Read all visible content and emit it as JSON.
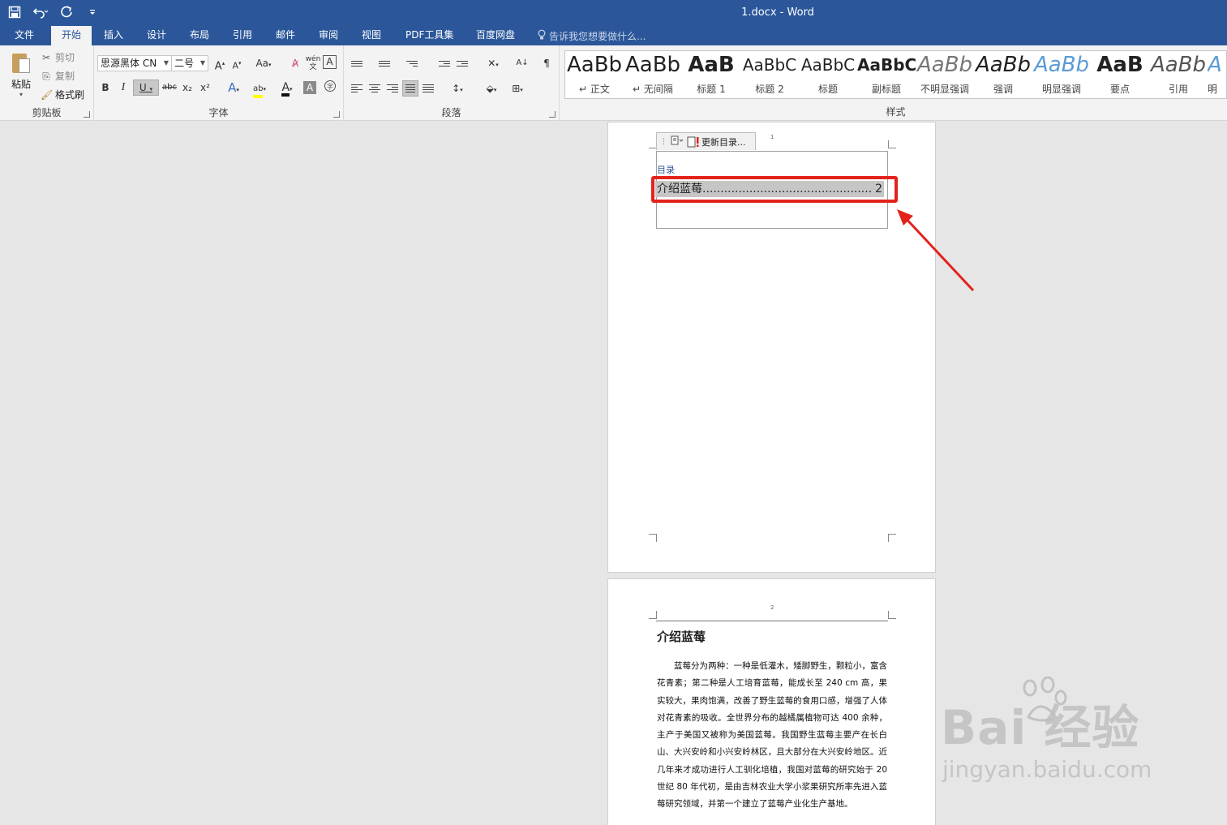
{
  "titlebar": {
    "document_title": "1.docx - Word",
    "qat_icons": [
      "save-icon",
      "undo-icon",
      "redo-icon",
      "customize-icon"
    ],
    "background": "#2b579a"
  },
  "tabs": {
    "file": "文件",
    "home": "开始",
    "insert": "插入",
    "design": "设计",
    "layout": "布局",
    "references": "引用",
    "mailings": "邮件",
    "review": "审阅",
    "view": "视图",
    "pdf_tools": "PDF工具集",
    "baidu_pan": "百度网盘",
    "tell_me": "告诉我您想要做什么..."
  },
  "ribbon": {
    "clipboard": {
      "label": "剪贴板",
      "paste": "粘贴",
      "cut": "剪切",
      "copy": "复制",
      "format_painter": "格式刷"
    },
    "font": {
      "label": "字体",
      "font_name": "思源黑体 CN",
      "font_size": "二号",
      "bold": "B",
      "italic": "I",
      "underline": "U",
      "strikethrough": "abc",
      "subscript": "x₂",
      "superscript": "x²",
      "change_case": "Aa"
    },
    "paragraph": {
      "label": "段落"
    },
    "styles": {
      "label": "样式",
      "items": [
        {
          "sample": "AaBb",
          "name": "正文"
        },
        {
          "sample": "AaBb",
          "name": "无间隔"
        },
        {
          "sample": "AaB",
          "name": "标题 1"
        },
        {
          "sample": "AaBbC",
          "name": "标题 2"
        },
        {
          "sample": "AaBbC",
          "name": "标题"
        },
        {
          "sample": "AaBbC",
          "name": "副标题"
        },
        {
          "sample": "AaBb",
          "name": "不明显强调"
        },
        {
          "sample": "AaBb",
          "name": "强调"
        },
        {
          "sample": "AaBb",
          "name": "明显强调"
        },
        {
          "sample": "AaB",
          "name": "要点"
        },
        {
          "sample": "AaBb",
          "name": "引用"
        },
        {
          "sample": "A",
          "name": "明"
        }
      ]
    }
  },
  "document": {
    "page1": {
      "page_number": "1",
      "toc_update_button": "更新目录...",
      "toc_heading": "目录",
      "toc_entry_title": "介绍蓝莓",
      "toc_entry_leader": "...............................................",
      "toc_entry_page": "2"
    },
    "page2": {
      "page_number": "2",
      "heading": "介绍蓝莓",
      "body": "蓝莓分为两种：一种是低灌木，矮脚野生，颗粒小，富含花青素；第二种是人工培育蓝莓，能成长至 240 cm 高，果实较大，果肉饱满，改善了野生蓝莓的食用口感，增强了人体对花青素的吸收。全世界分布的越橘属植物可达 400 余种，主产于美国又被称为美国蓝莓。我国野生蓝莓主要产在长白山、大兴安岭和小兴安岭林区，且大部分在大兴安岭地区。近几年来才成功进行人工驯化培植，我国对蓝莓的研究始于 20 世纪 80 年代初，是由吉林农业大学小浆果研究所率先进入蓝莓研究领域，并第一个建立了蓝莓产业化生产基地。"
    }
  },
  "annotation": {
    "color": "#e3221b"
  },
  "watermark": {
    "main": "Bai 经验",
    "sub": "jingyan.baidu.com"
  }
}
